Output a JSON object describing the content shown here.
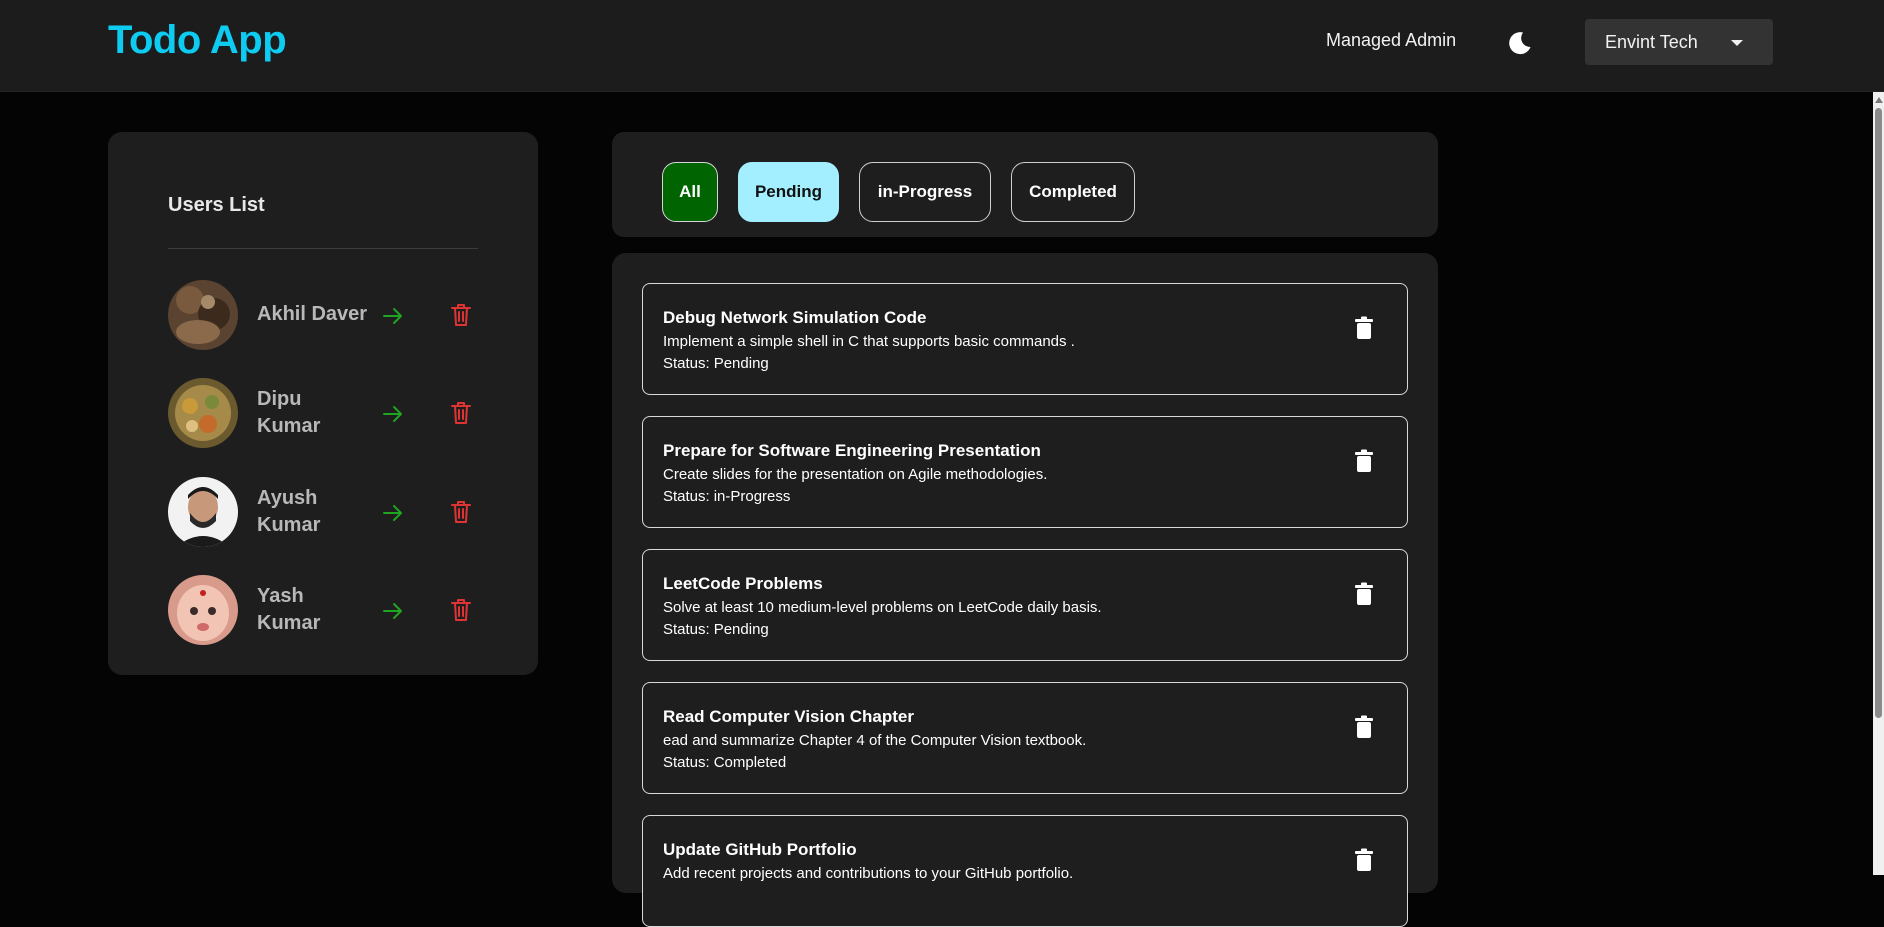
{
  "header": {
    "brand": "Todo App",
    "admin_label": "Managed Admin",
    "theme_icon": "moon-icon",
    "org_select": {
      "selected": "Envint Tech"
    }
  },
  "users": {
    "title": "Users List",
    "items": [
      {
        "first": "Akhil Daver",
        "last": ""
      },
      {
        "first": "Dipu",
        "last": "Kumar"
      },
      {
        "first": "Ayush",
        "last": "Kumar"
      },
      {
        "first": "Yash",
        "last": "Kumar"
      }
    ],
    "go_icon": "arrow-right-icon",
    "delete_icon": "trash-icon"
  },
  "filters": {
    "items": [
      "All",
      "Pending",
      "in-Progress",
      "Completed"
    ],
    "active": "All",
    "highlighted": "Pending"
  },
  "todos": {
    "status_prefix": "Status:",
    "items": [
      {
        "title": "Debug Network Simulation Code",
        "description": "Implement a simple shell in C that supports basic commands .",
        "status": "Pending"
      },
      {
        "title": "Prepare for Software Engineering Presentation",
        "description": "Create slides for the presentation on Agile methodologies.",
        "status": "in-Progress"
      },
      {
        "title": "LeetCode Problems",
        "description": "Solve at least 10 medium-level problems on LeetCode daily basis.",
        "status": "Pending"
      },
      {
        "title": "Read Computer Vision Chapter",
        "description": "ead and summarize Chapter 4 of the Computer Vision textbook.",
        "status": "Completed"
      },
      {
        "title": "Update GitHub Portfolio",
        "description": "Add recent projects and contributions to your GitHub portfolio.",
        "status": ""
      }
    ]
  },
  "colors": {
    "brand": "#0ecbf2",
    "active_chip": "#006400",
    "highlight_chip": "#a4efff",
    "arrow": "#1fa51f",
    "delete": "#e03434"
  }
}
